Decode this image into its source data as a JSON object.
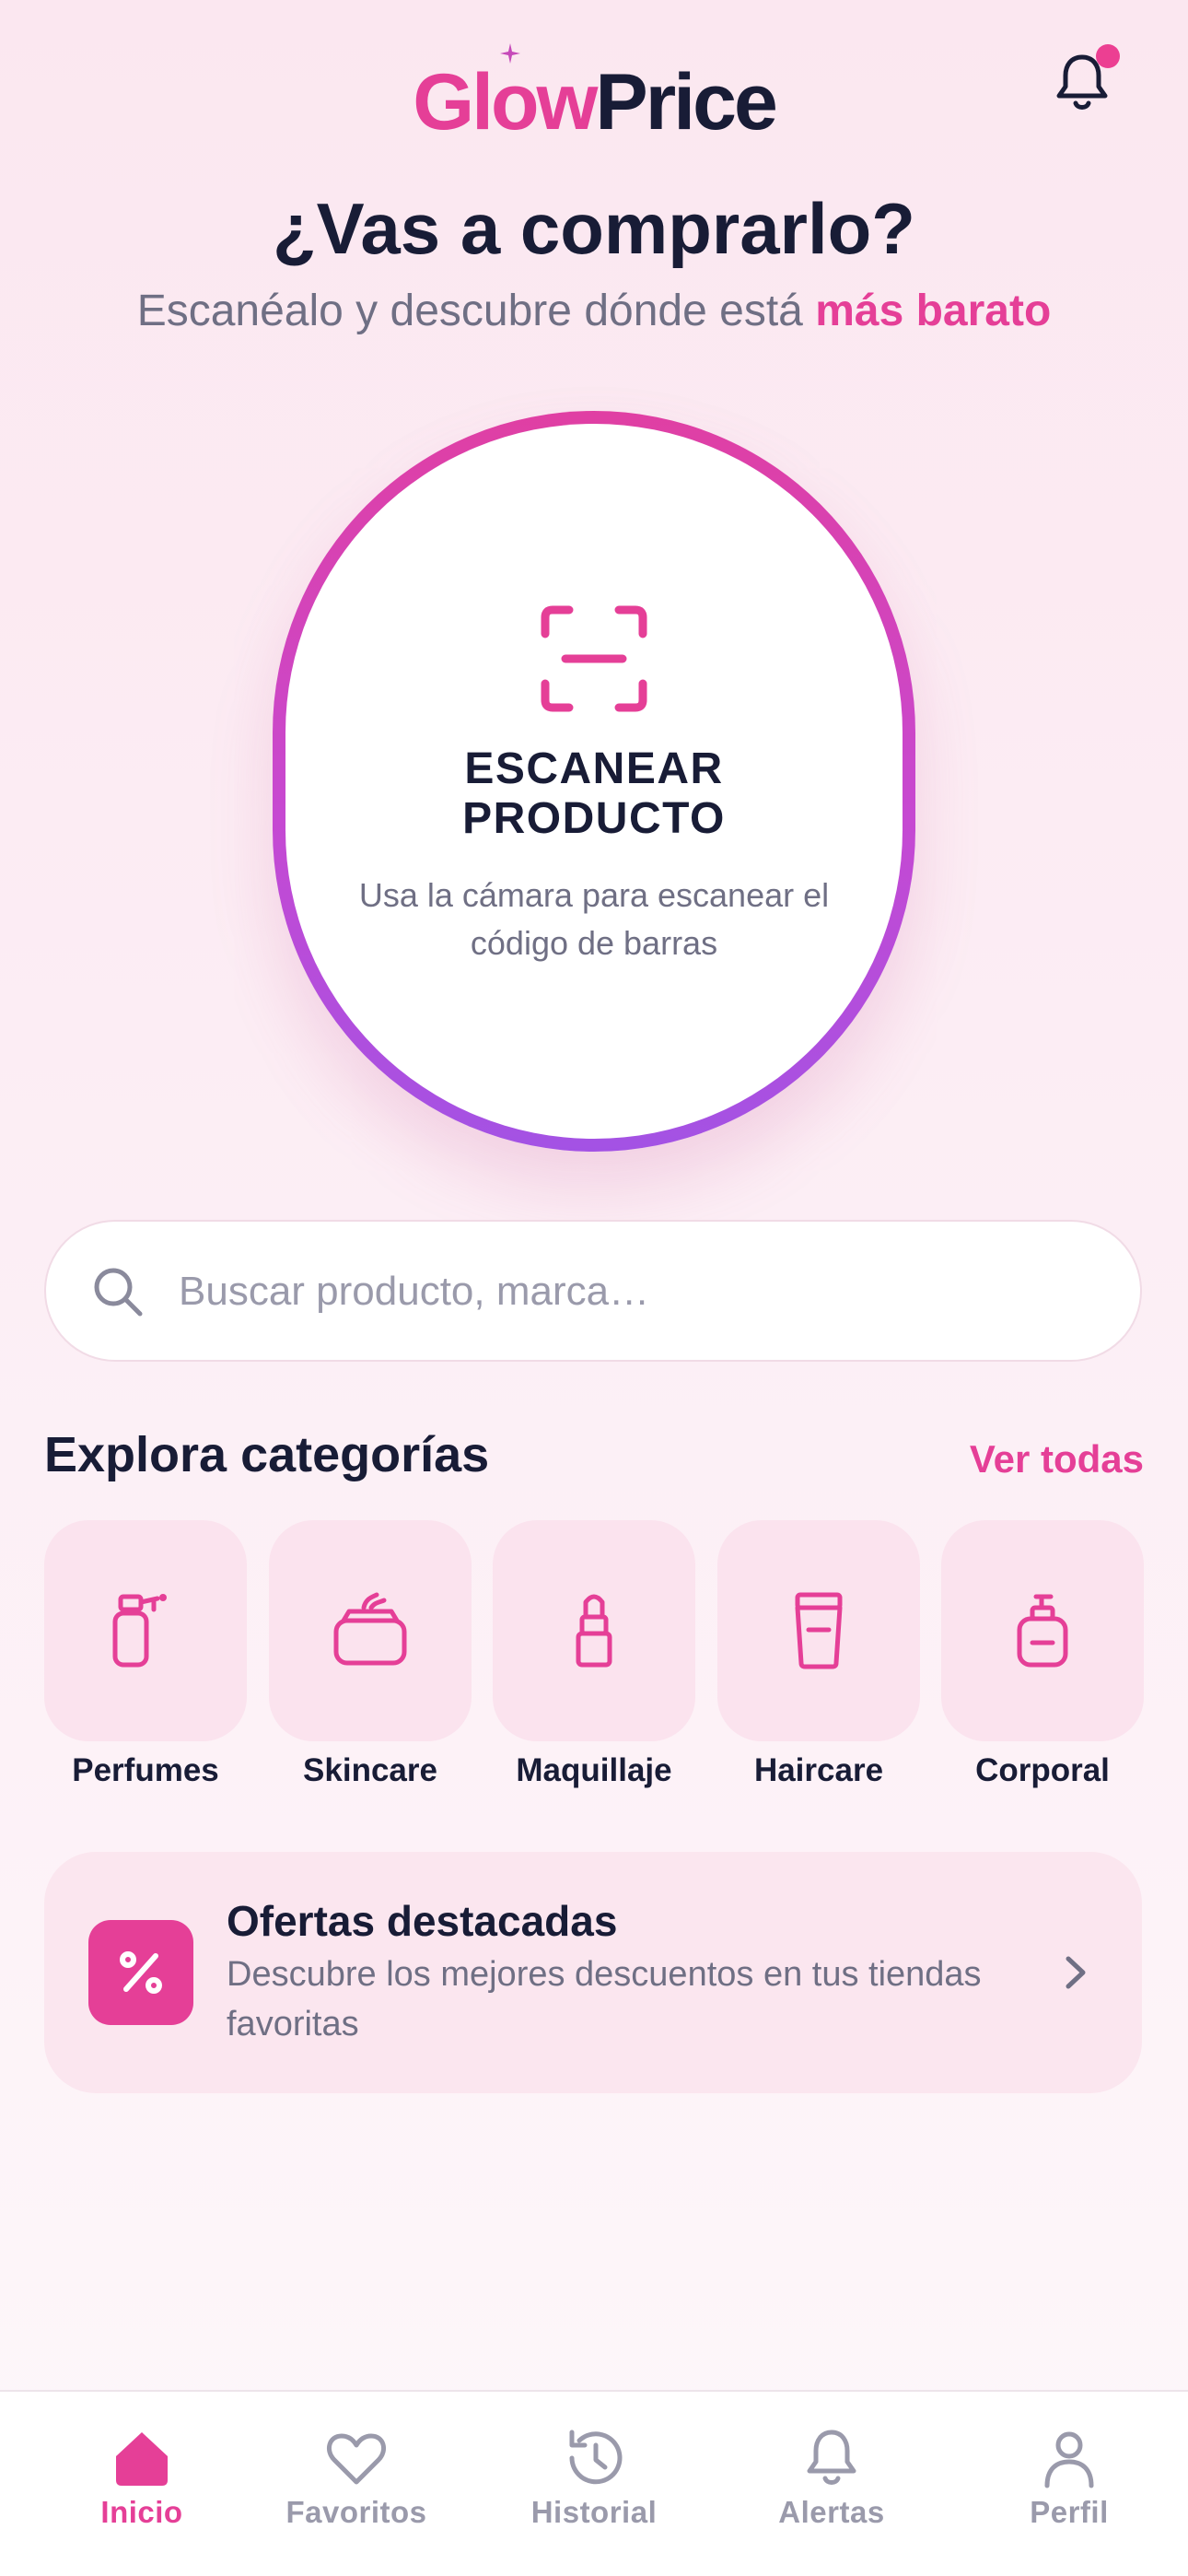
{
  "app": {
    "logo_part1": "Glow",
    "logo_part2": "Price"
  },
  "header": {
    "notifications_icon": "bell-icon",
    "has_unread": true
  },
  "hero": {
    "title": "¿Vas a comprarlo?",
    "subtitle_prefix": "Escanéalo y descubre dónde está ",
    "subtitle_highlight": "más barato"
  },
  "scan": {
    "icon": "barcode-scan-icon",
    "title_line1": "ESCANEAR",
    "title_line2": "PRODUCTO",
    "description": "Usa la cámara para escanear el código de barras"
  },
  "search": {
    "placeholder": "Buscar producto, marca…",
    "value": ""
  },
  "categories": {
    "title": "Explora categorías",
    "see_all": "Ver todas",
    "items": [
      {
        "label": "Perfumes",
        "icon": "perfume-bottle-icon"
      },
      {
        "label": "Skincare",
        "icon": "cream-jar-icon"
      },
      {
        "label": "Maquillaje",
        "icon": "lipstick-icon"
      },
      {
        "label": "Haircare",
        "icon": "hair-product-icon"
      },
      {
        "label": "Corporal",
        "icon": "lotion-pump-icon"
      }
    ]
  },
  "offers": {
    "icon": "percent-icon",
    "title": "Ofertas destacadas",
    "description": "Descubre los mejores descuentos en tus tiendas favoritas"
  },
  "nav": {
    "items": [
      {
        "label": "Inicio",
        "icon": "home-icon",
        "active": true
      },
      {
        "label": "Favoritos",
        "icon": "heart-icon",
        "active": false
      },
      {
        "label": "Historial",
        "icon": "history-icon",
        "active": false
      },
      {
        "label": "Alertas",
        "icon": "bell-icon",
        "active": false
      },
      {
        "label": "Perfil",
        "icon": "user-icon",
        "active": false
      }
    ]
  },
  "colors": {
    "accent": "#e53f97",
    "accent_gradient_end": "#a352e4",
    "text_dark": "#181c36",
    "text_muted": "#6f6f84",
    "tile_bg": "#fbe3ee"
  }
}
